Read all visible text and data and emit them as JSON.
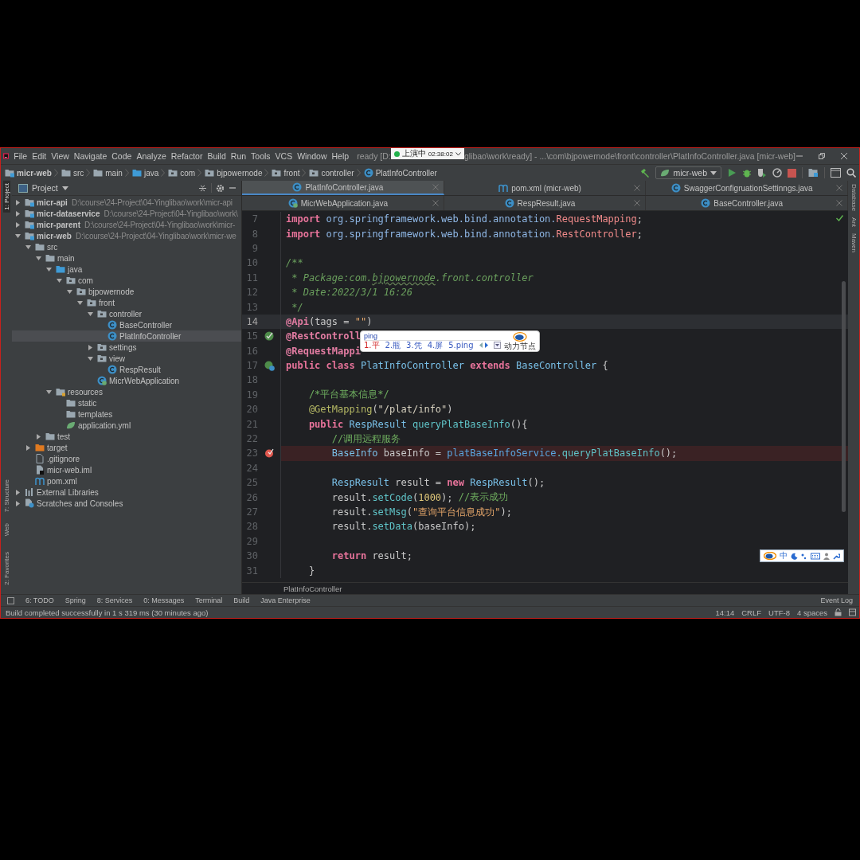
{
  "menu_bar": {
    "items": [
      "File",
      "Edit",
      "View",
      "Navigate",
      "Code",
      "Analyze",
      "Refactor",
      "Build",
      "Run",
      "Tools",
      "VCS",
      "Window",
      "Help"
    ],
    "title_start": "ready [D:",
    "title_end": "glibao\\work\\ready] - ...\\com\\bjpowernode\\front\\controller\\PlatInfoController.java [micr-web]"
  },
  "recording_badge": {
    "label": "上演中",
    "time": "02:38:02"
  },
  "breadcrumbs": [
    {
      "label": "micr-web",
      "kind": "module"
    },
    {
      "label": "src",
      "kind": "folder"
    },
    {
      "label": "main",
      "kind": "folder"
    },
    {
      "label": "java",
      "kind": "source-folder"
    },
    {
      "label": "com",
      "kind": "package"
    },
    {
      "label": "bjpowernode",
      "kind": "package"
    },
    {
      "label": "front",
      "kind": "package"
    },
    {
      "label": "controller",
      "kind": "package"
    },
    {
      "label": "PlatInfoController",
      "kind": "class"
    }
  ],
  "run_config": "micr-web",
  "left_strip": [
    {
      "label": "1: Project",
      "selected": true
    },
    {
      "label": "7: Structure",
      "selected": false
    },
    {
      "label": "Web",
      "selected": false
    },
    {
      "label": "2: Favorites",
      "selected": false
    }
  ],
  "right_strip": [
    "Database",
    "Ant",
    "Maven"
  ],
  "project": {
    "title": "Project",
    "tree": [
      {
        "name": "micr-api",
        "path": "D:\\course\\24-Project\\04-Yinglibao\\work\\micr-api",
        "kind": "module",
        "expanded": false,
        "selected": false
      },
      {
        "name": "micr-dataservice",
        "path": "D:\\course\\24-Project\\04-Yinglibao\\work\\",
        "kind": "module",
        "expanded": false,
        "selected": false
      },
      {
        "name": "micr-parent",
        "path": "D:\\course\\24-Project\\04-Yinglibao\\work\\micr-",
        "kind": "module",
        "expanded": false,
        "selected": false
      },
      {
        "name": "micr-web",
        "path": "D:\\course\\24-Project\\04-Yinglibao\\work\\micr-we",
        "kind": "module",
        "expanded": true,
        "selected": false,
        "children": [
          {
            "name": "src",
            "kind": "folder",
            "expanded": true,
            "selected": false,
            "children": [
              {
                "name": "main",
                "kind": "folder",
                "expanded": true,
                "selected": false,
                "children": [
                  {
                    "name": "java",
                    "kind": "source-folder",
                    "expanded": true,
                    "selected": false,
                    "children": [
                      {
                        "name": "com",
                        "kind": "package",
                        "expanded": true,
                        "selected": false,
                        "children": [
                          {
                            "name": "bjpowernode",
                            "kind": "package",
                            "expanded": true,
                            "selected": false,
                            "children": [
                              {
                                "name": "front",
                                "kind": "package",
                                "expanded": true,
                                "selected": false,
                                "children": [
                                  {
                                    "name": "controller",
                                    "kind": "package",
                                    "expanded": true,
                                    "selected": false,
                                    "children": [
                                      {
                                        "name": "BaseController",
                                        "kind": "class",
                                        "selected": false
                                      },
                                      {
                                        "name": "PlatInfoController",
                                        "kind": "class",
                                        "selected": true
                                      }
                                    ]
                                  },
                                  {
                                    "name": "settings",
                                    "kind": "package",
                                    "expanded": false,
                                    "selected": false
                                  },
                                  {
                                    "name": "view",
                                    "kind": "package",
                                    "expanded": true,
                                    "selected": false,
                                    "children": [
                                      {
                                        "name": "RespResult",
                                        "kind": "class",
                                        "selected": false
                                      }
                                    ]
                                  },
                                  {
                                    "name": "MicrWebApplication",
                                    "kind": "spring-class",
                                    "selected": false
                                  }
                                ]
                              }
                            ]
                          }
                        ]
                      }
                    ]
                  },
                  {
                    "name": "resources",
                    "kind": "resources",
                    "expanded": true,
                    "selected": false,
                    "children": [
                      {
                        "name": "static",
                        "kind": "folder",
                        "selected": false
                      },
                      {
                        "name": "templates",
                        "kind": "folder",
                        "selected": false
                      },
                      {
                        "name": "application.yml",
                        "kind": "yml",
                        "selected": false
                      }
                    ]
                  }
                ]
              },
              {
                "name": "test",
                "kind": "folder",
                "expanded": false,
                "selected": false
              }
            ]
          },
          {
            "name": "target",
            "kind": "excluded-folder",
            "expanded": false,
            "selected": false
          },
          {
            "name": ".gitignore",
            "kind": "file",
            "selected": false
          },
          {
            "name": "micr-web.iml",
            "kind": "iml",
            "selected": false
          },
          {
            "name": "pom.xml",
            "kind": "maven",
            "selected": false
          }
        ]
      },
      {
        "name": "External Libraries",
        "kind": "libraries",
        "expanded": false,
        "selected": false
      },
      {
        "name": "Scratches and Consoles",
        "kind": "scratches",
        "expanded": false,
        "selected": false
      }
    ]
  },
  "tab_rows": [
    [
      {
        "label": "PlatInfoController.java",
        "kind": "class",
        "selected": true
      },
      {
        "label": "pom.xml (micr-web)",
        "kind": "maven",
        "selected": false
      },
      {
        "label": "SwaggerConfigruationSettinngs.java",
        "kind": "class",
        "selected": false
      }
    ],
    [
      {
        "label": "MicrWebApplication.java",
        "kind": "spring-class",
        "selected": false
      },
      {
        "label": "RespResult.java",
        "kind": "class",
        "selected": false
      },
      {
        "label": "BaseController.java",
        "kind": "class",
        "selected": false
      }
    ]
  ],
  "editor": {
    "breadcrumb": "PlatInfoController",
    "lines": [
      {
        "number": "7",
        "tokens": [
          {
            "kind": "kw",
            "text": "import"
          },
          {
            "kind": "pkg",
            "text": " org.springframework.web.bind.annotation."
          },
          {
            "kind": "icls",
            "text": "RequestMapping"
          },
          {
            "kind": "plain",
            "text": ";"
          }
        ]
      },
      {
        "number": "8",
        "tokens": [
          {
            "kind": "kw",
            "text": "import"
          },
          {
            "kind": "pkg",
            "text": " org.springframework.web.bind.annotation."
          },
          {
            "kind": "icls",
            "text": "RestController"
          },
          {
            "kind": "plain",
            "text": ";"
          }
        ]
      },
      {
        "number": "9"
      },
      {
        "number": "10",
        "tokens": [
          {
            "kind": "doc",
            "text": "/**"
          }
        ]
      },
      {
        "number": "11",
        "tokens": [
          {
            "kind": "doc",
            "text": " * Package:com."
          },
          {
            "kind": "typo",
            "text": "bjpowernode"
          },
          {
            "kind": "doc",
            "text": ".front.controller"
          }
        ]
      },
      {
        "number": "12",
        "tokens": [
          {
            "kind": "doc",
            "text": " * Date:2022/3/1 16:26"
          }
        ]
      },
      {
        "number": "13",
        "tokens": [
          {
            "kind": "doc",
            "text": " */"
          }
        ]
      },
      {
        "number": "14",
        "current": true,
        "tokens": [
          {
            "kind": "ann",
            "text": "@Api"
          },
          {
            "kind": "plain",
            "text": "(tags = "
          },
          {
            "kind": "str",
            "text": "\"\""
          },
          {
            "kind": "plain",
            "text": ")"
          }
        ]
      },
      {
        "number": "15",
        "kind": "bean",
        "tokens": [
          {
            "kind": "ann",
            "text": "@RestControll"
          }
        ]
      },
      {
        "number": "16",
        "tokens": [
          {
            "kind": "ann",
            "text": "@RequestMappi"
          }
        ]
      },
      {
        "number": "17",
        "kind": "bean-class",
        "tokens": [
          {
            "kind": "kw",
            "text": "public class"
          },
          {
            "kind": "cls",
            "text": " PlatInfoController"
          },
          {
            "kind": "kw",
            "text": " extends"
          },
          {
            "kind": "cls",
            "text": " BaseController"
          },
          {
            "kind": "plain",
            "text": " {"
          }
        ]
      },
      {
        "number": "18"
      },
      {
        "number": "19",
        "tokens": [
          {
            "kind": "comment",
            "text": "    /*平台基本信息*/"
          }
        ]
      },
      {
        "number": "20",
        "tokens": [
          {
            "kind": "ann2",
            "text": "    @GetMapping"
          },
          {
            "kind": "plain",
            "text": "("
          },
          {
            "kind": "str2",
            "text": "\"/plat/info\""
          },
          {
            "kind": "plain",
            "text": ")"
          }
        ]
      },
      {
        "number": "21",
        "tokens": [
          {
            "kind": "kw",
            "text": "    public"
          },
          {
            "kind": "cls",
            "text": " RespResult"
          },
          {
            "kind": "method",
            "text": " queryPlatBaseInfo"
          },
          {
            "kind": "plain",
            "text": "(){"
          }
        ]
      },
      {
        "number": "22",
        "tokens": [
          {
            "kind": "comment",
            "text": "        //调用远程服务"
          }
        ]
      },
      {
        "number": "23",
        "kind": "breakpoint",
        "tokens": [
          {
            "kind": "cls",
            "text": "        BaseInfo"
          },
          {
            "kind": "plain",
            "text": " baseInfo = "
          },
          {
            "kind": "field",
            "text": "platBaseInfoService"
          },
          {
            "kind": "method",
            "text": ".queryPlatBaseInfo"
          },
          {
            "kind": "plain",
            "text": "();"
          }
        ]
      },
      {
        "number": "24"
      },
      {
        "number": "25",
        "tokens": [
          {
            "kind": "cls",
            "text": "        RespResult"
          },
          {
            "kind": "plain",
            "text": " result = "
          },
          {
            "kind": "kw",
            "text": "new"
          },
          {
            "kind": "cls",
            "text": " RespResult"
          },
          {
            "kind": "plain",
            "text": "();"
          }
        ]
      },
      {
        "number": "26",
        "tokens": [
          {
            "kind": "plain",
            "text": "        result."
          },
          {
            "kind": "method",
            "text": "setCode"
          },
          {
            "kind": "plain",
            "text": "("
          },
          {
            "kind": "num",
            "text": "1000"
          },
          {
            "kind": "plain",
            "text": "); "
          },
          {
            "kind": "comment",
            "text": "//表示成功"
          }
        ]
      },
      {
        "number": "27",
        "tokens": [
          {
            "kind": "plain",
            "text": "        result."
          },
          {
            "kind": "method",
            "text": "setMsg"
          },
          {
            "kind": "plain",
            "text": "("
          },
          {
            "kind": "str",
            "text": "\"查询平台信息成功\""
          },
          {
            "kind": "plain",
            "text": ");"
          }
        ]
      },
      {
        "number": "28",
        "tokens": [
          {
            "kind": "plain",
            "text": "        result."
          },
          {
            "kind": "method",
            "text": "setData"
          },
          {
            "kind": "plain",
            "text": "(baseInfo);"
          }
        ]
      },
      {
        "number": "29"
      },
      {
        "number": "30",
        "tokens": [
          {
            "kind": "kw",
            "text": "        return"
          },
          {
            "kind": "plain",
            "text": " result;"
          }
        ]
      },
      {
        "number": "31",
        "tokens": [
          {
            "kind": "plain",
            "text": "    }"
          }
        ]
      }
    ]
  },
  "ime_popup": {
    "input": "ping",
    "candidates": [
      {
        "text": "1.平",
        "selected": true
      },
      {
        "text": "2.瓶",
        "selected": false
      },
      {
        "text": "3.凭",
        "selected": false
      },
      {
        "text": "4.屏",
        "selected": false
      },
      {
        "text": "5.ping",
        "selected": false
      }
    ],
    "logo_text": "动力节点"
  },
  "ime_toolbar": {
    "mode": "中"
  },
  "tool_tabs": [
    "6: TODO",
    "Spring",
    "8: Services",
    "0: Messages",
    "Terminal",
    "Build",
    "Java Enterprise"
  ],
  "event_log": "Event Log",
  "status_bar": {
    "message": "Build completed successfully in 1 s 319 ms (30 minutes ago)",
    "items": [
      "14:14",
      "CRLF",
      "UTF-8",
      "4 spaces"
    ]
  }
}
